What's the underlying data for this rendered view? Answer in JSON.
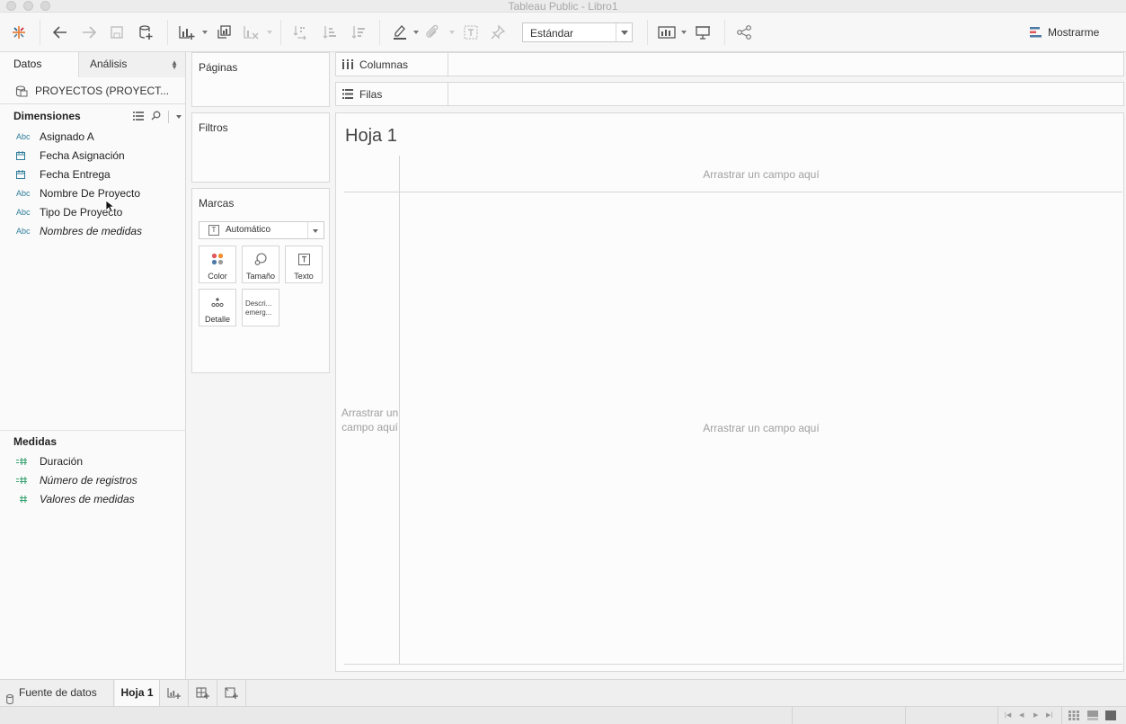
{
  "window": {
    "title": "Tableau Public - Libro1"
  },
  "toolbar": {
    "view_style": "Estándar",
    "show_me_label": "Mostrarme",
    "icons": [
      "tableau-logo-icon",
      "undo-icon",
      "redo-icon",
      "save-icon",
      "new-datasource-icon",
      "new-worksheet-icon",
      "duplicate-sheet-icon",
      "clear-sheet-icon",
      "swap-icon",
      "sort-ascending-icon",
      "sort-descending-icon",
      "highlight-icon",
      "group-icon",
      "labels-icon",
      "pin-icon",
      "fit-icon",
      "presentation-icon",
      "share-icon"
    ]
  },
  "data_pane": {
    "tabs": [
      "Datos",
      "Análisis"
    ],
    "datasource": "PROYECTOS (PROYECT...",
    "dimensions_header": "Dimensiones",
    "dimensions": [
      {
        "type": "Abc",
        "name": "Asignado A",
        "italic": false
      },
      {
        "type": "date",
        "name": "Fecha Asignación",
        "italic": false
      },
      {
        "type": "date",
        "name": "Fecha Entrega",
        "italic": false
      },
      {
        "type": "Abc",
        "name": "Nombre De Proyecto",
        "italic": false
      },
      {
        "type": "Abc",
        "name": "Tipo De Proyecto",
        "italic": false
      },
      {
        "type": "Abc",
        "name": "Nombres de medidas",
        "italic": true
      }
    ],
    "measures_header": "Medidas",
    "measures": [
      {
        "type": "=#",
        "name": "Duración",
        "italic": false
      },
      {
        "type": "=#",
        "name": "Número de registros",
        "italic": true
      },
      {
        "type": "#",
        "name": "Valores de medidas",
        "italic": true
      }
    ]
  },
  "cards": {
    "pages": "Páginas",
    "filters": "Filtros",
    "marks": "Marcas",
    "mark_type": "Automático",
    "mark_buttons": [
      "Color",
      "Tamaño",
      "Texto",
      "Detalle",
      "Descri... emerg..."
    ]
  },
  "shelves": {
    "columns": "Columnas",
    "rows": "Filas"
  },
  "view": {
    "title": "Hoja 1",
    "drop_top": "Arrastrar un campo aquí",
    "drop_left": "Arrastrar un campo aquí",
    "drop_center": "Arrastrar un campo aquí"
  },
  "sheets": {
    "datasource_tab": "Fuente de datos",
    "active_tab": "Hoja 1"
  }
}
